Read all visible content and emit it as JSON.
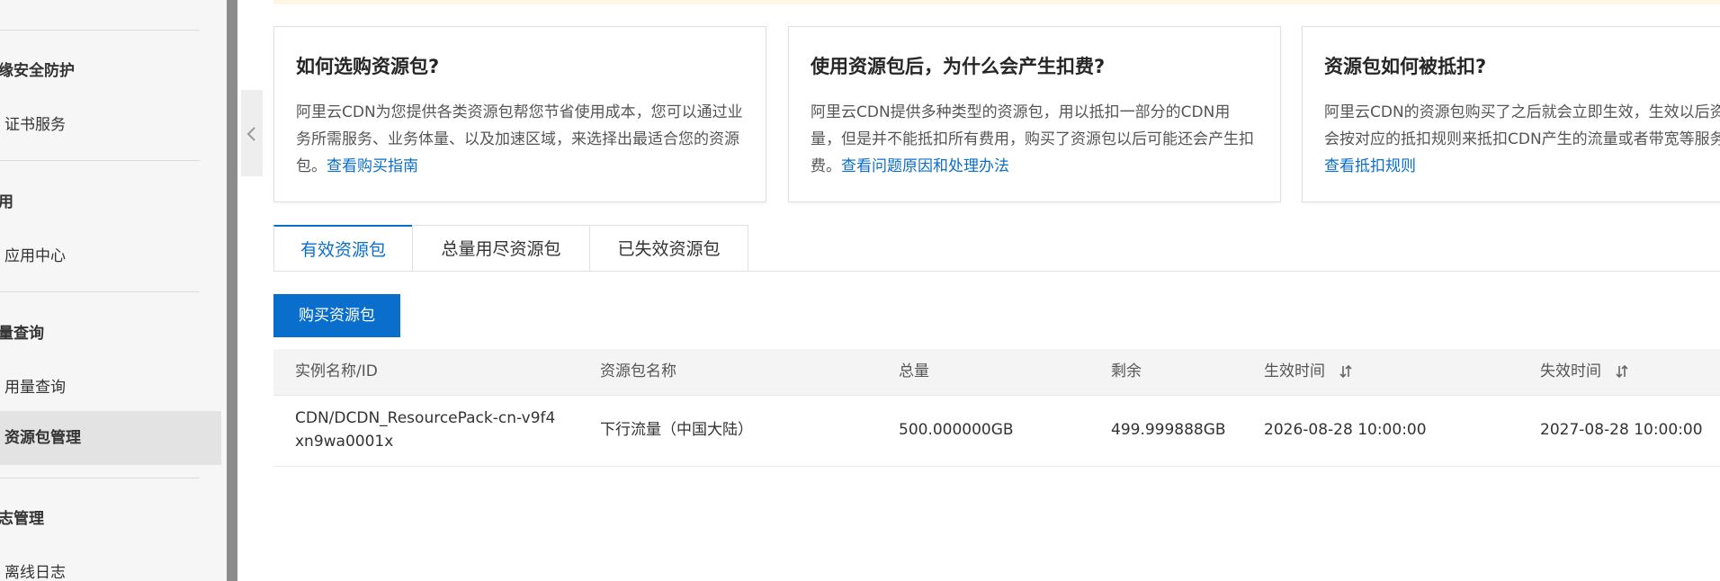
{
  "sidebar": {
    "groups": [
      {
        "label": "缘安全防护",
        "items": [
          {
            "label": "证书服务"
          }
        ]
      },
      {
        "label": "用",
        "items": [
          {
            "label": "应用中心"
          }
        ]
      },
      {
        "label": "量查询",
        "items": [
          {
            "label": "用量查询"
          },
          {
            "label": "资源包管理",
            "active": true
          }
        ]
      },
      {
        "label": "志管理",
        "items": [
          {
            "label": "离线日志"
          }
        ]
      }
    ]
  },
  "cards": [
    {
      "title": "如何选购资源包?",
      "body": "阿里云CDN为您提供各类资源包帮您节省使用成本，您可以通过业务所需服务、业务体量、以及加速区域，来选择出最适合您的资源包。",
      "link": "查看购买指南"
    },
    {
      "title": "使用资源包后，为什么会产生扣费?",
      "body": "阿里云CDN提供多种类型的资源包，用以抵扣一部分的CDN用量，但是并不能抵扣所有费用，购买了资源包以后可能还会产生扣费。",
      "link": "查看问题原因和处理办法"
    },
    {
      "title": "资源包如何被抵扣?",
      "body": "阿里云CDN的资源包购买了之后就会立即生效，生效以后资源包将会按对应的抵扣规则来抵扣CDN产生的流量或者带宽等服务用量。",
      "link": "查看抵扣规则"
    }
  ],
  "tabs": [
    {
      "label": "有效资源包",
      "active": true
    },
    {
      "label": "总量用尽资源包"
    },
    {
      "label": "已失效资源包"
    }
  ],
  "buy_button": "购买资源包",
  "table": {
    "columns": [
      "实例名称/ID",
      "资源包名称",
      "总量",
      "剩余",
      "生效时间",
      "失效时间"
    ],
    "rows": [
      {
        "instance": "CDN/DCDN_ResourcePack-cn-v9f4xn9wa0001x",
        "package": "下行流量（中国大陆）",
        "total": "500.000000GB",
        "remaining": "499.999888GB",
        "effective": "2026-08-28 10:00:00",
        "expire": "2027-08-28 10:00:00"
      }
    ]
  },
  "colors": {
    "accent": "#0a6ecc",
    "sidebar_bg": "#f6f6f6",
    "header_bg": "#f4f4f4"
  }
}
